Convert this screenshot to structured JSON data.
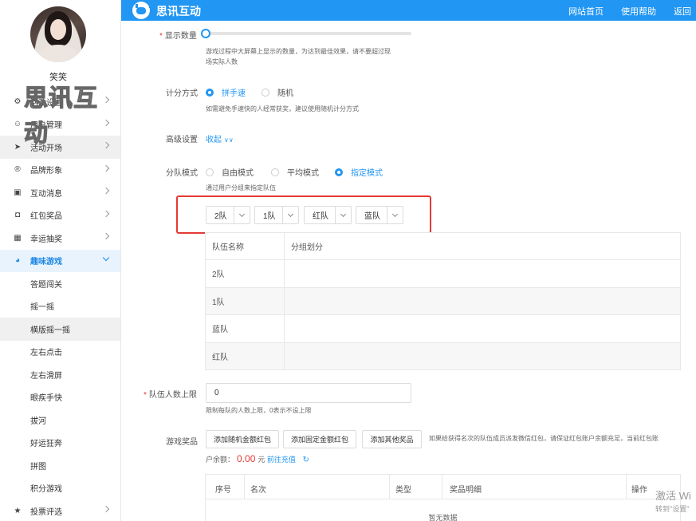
{
  "header": {
    "logo_text": "思讯互动",
    "nav": [
      "网站首页",
      "使用帮助",
      "返回"
    ]
  },
  "sidebar": {
    "user_name": "笑笑",
    "watermark": "思讯互动",
    "menu": [
      {
        "label": "活动设置",
        "icon": "gear-icon",
        "glyph": "⚙"
      },
      {
        "label": "用户管理",
        "icon": "user-icon",
        "glyph": "👤"
      },
      {
        "label": "活动开场",
        "icon": "paper-plane-icon",
        "glyph": "➤"
      },
      {
        "label": "品牌形象",
        "icon": "registered-icon",
        "glyph": "®"
      },
      {
        "label": "互动消息",
        "icon": "chat-icon",
        "glyph": "▣"
      },
      {
        "label": "红包奖品",
        "icon": "red-packet-icon",
        "glyph": "◘"
      },
      {
        "label": "幸运抽奖",
        "icon": "lottery-icon",
        "glyph": "▦"
      },
      {
        "label": "趣味游戏",
        "icon": "pacman-icon",
        "glyph": "◕"
      }
    ],
    "sub_items": [
      "答题闯关",
      "摇一摇",
      "横版摇一摇",
      "左右点击",
      "左右滑屏",
      "眼疾手快",
      "拔河",
      "好运狂奔",
      "拼图",
      "积分游戏"
    ],
    "last_menu": {
      "label": "投票评选",
      "icon": "star-icon",
      "glyph": "★"
    }
  },
  "form": {
    "display_count": {
      "label": "显示数量",
      "hint_line1": "游戏过程中大屏幕上显示的数量，为达到最佳效果，请不要超过现",
      "hint_line2": "场实际人数"
    },
    "scoring": {
      "label": "计分方式",
      "options": [
        "拼手速",
        "随机"
      ],
      "hint": "如需避免手速快的人经常获奖，建议使用随机计分方式"
    },
    "advanced": {
      "label": "高级设置",
      "toggle": "收起",
      "toggle_icon": "double-chevron-icon"
    },
    "team_mode": {
      "label": "分队模式",
      "options": [
        "自由模式",
        "平均模式",
        "指定模式"
      ],
      "hint": "通过用户分组来指定队伍",
      "selects": [
        "2队",
        "1队",
        "红队",
        "蓝队"
      ]
    },
    "team_table": {
      "headers": [
        "队伍名称",
        "分组划分"
      ],
      "rows": [
        "2队",
        "1队",
        "蓝队",
        "红队"
      ]
    },
    "team_limit": {
      "label": "队伍人数上限",
      "value": "0",
      "hint": "限制每队的人数上限，0表示不设上限"
    },
    "prizes": {
      "label": "游戏奖品",
      "buttons": [
        "添加随机金额红包",
        "添加固定金额红包",
        "添加其他奖品"
      ],
      "hint": "如果给获得名次的队伍成员派发微信红包，请保证红包账户余额充足，当前红包账",
      "balance_prefix": "户余额：",
      "balance_amount": "0.00",
      "balance_unit": "元",
      "recharge": "前往充值",
      "refresh_icon": "refresh-icon",
      "table_headers": [
        "序号",
        "名次",
        "类型",
        "奖品明细",
        "操作"
      ],
      "empty_text": "暂无数据"
    }
  },
  "activation": {
    "line1": "激活 Wi",
    "line2": "转到\"设置\""
  }
}
